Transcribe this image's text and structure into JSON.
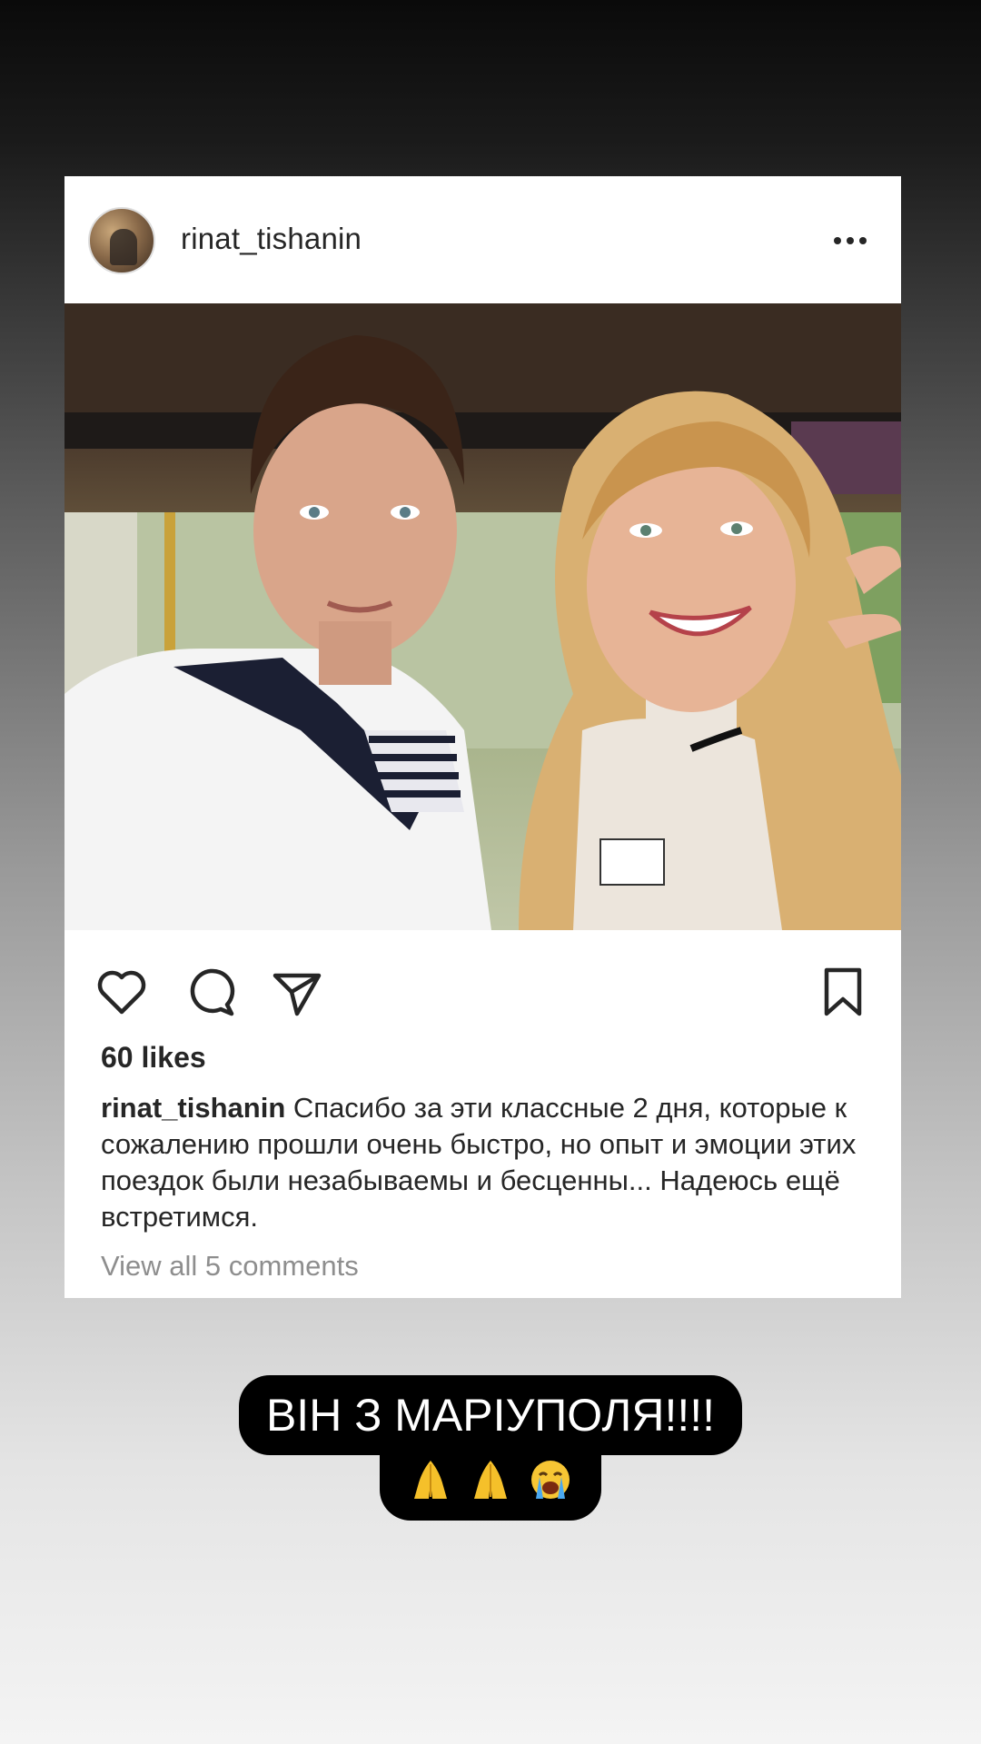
{
  "post": {
    "username": "rinat_tishanin",
    "likes": "60 likes",
    "caption_user": "rinat_tishanin",
    "caption_text": "Спасибо за эти классные 2 дня, которые к сожалению прошли очень быстро, но опыт и эмоции этих поездок были незабываемы и бесценны... Надеюсь ещё встретимся.",
    "view_comments": "View all 5 comments"
  },
  "story": {
    "sticker_text": "ВІН З МАРІУПОЛЯ!!!!",
    "emojis": [
      "folded-hands",
      "folded-hands",
      "loudly-crying-face"
    ]
  },
  "icons": {
    "more": "more-options-icon",
    "like": "heart-icon",
    "comment": "comment-bubble-icon",
    "share": "paper-plane-icon",
    "save": "bookmark-icon"
  }
}
